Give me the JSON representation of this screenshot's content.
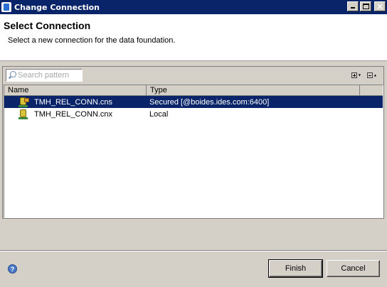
{
  "window": {
    "title": "Change Connection"
  },
  "header": {
    "title": "Select Connection",
    "description": "Select a new connection for the data foundation."
  },
  "search": {
    "placeholder": "Search pattern",
    "value": ""
  },
  "toolbar": {
    "expand_icon": "expand-all-icon",
    "collapse_icon": "collapse-all-icon"
  },
  "table": {
    "columns": [
      "Name",
      "Type"
    ],
    "rows": [
      {
        "name": "TMH_REL_CONN.cns",
        "type": "Secured [@boides.ides.com:6400]",
        "selected": true,
        "icon": "secured-connection-icon"
      },
      {
        "name": "TMH_REL_CONN.cnx",
        "type": "Local",
        "selected": false,
        "icon": "local-connection-icon"
      }
    ]
  },
  "footer": {
    "finish_label": "Finish",
    "cancel_label": "Cancel",
    "help_icon": "help-icon"
  },
  "colors": {
    "title_bar": "#0a246a",
    "selection": "#0a246a",
    "dialog_bg": "#d4d0c8"
  }
}
